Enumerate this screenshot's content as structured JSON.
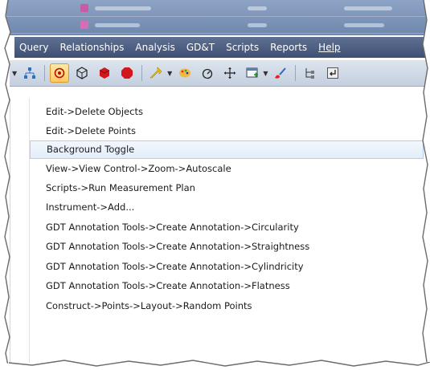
{
  "menubar": {
    "items": [
      "Query",
      "Relationships",
      "Analysis",
      "GD&T",
      "Scripts",
      "Reports",
      "Help"
    ]
  },
  "toolbar": {
    "icons": [
      "dropdown-arrow-icon",
      "hierarchy-icon",
      "gear-icon",
      "cube-outline-icon",
      "red-cube-icon",
      "red-hexagon-icon",
      "yellow-arrow-icon",
      "palette-icon",
      "rotate-icon",
      "move-icon",
      "window-icon",
      "brush-icon",
      "tree-icon",
      "return-icon"
    ]
  },
  "list": {
    "items": [
      "Edit->Delete Objects",
      "Edit->Delete Points",
      "Background Toggle",
      "View->View Control->Zoom->Autoscale",
      "Scripts->Run Measurement Plan",
      "Instrument->Add...",
      "GDT Annotation Tools->Create Annotation->Circularity",
      "GDT Annotation Tools->Create Annotation->Straightness",
      "GDT Annotation Tools->Create Annotation->Cylindricity",
      "GDT Annotation Tools->Create Annotation->Flatness",
      "Construct->Points->Layout->Random Points"
    ],
    "selected_index": 2
  },
  "colors": {
    "menubar": "#4a5b7e",
    "selection": "#e3eefa",
    "active_tool": "#ffc960"
  }
}
